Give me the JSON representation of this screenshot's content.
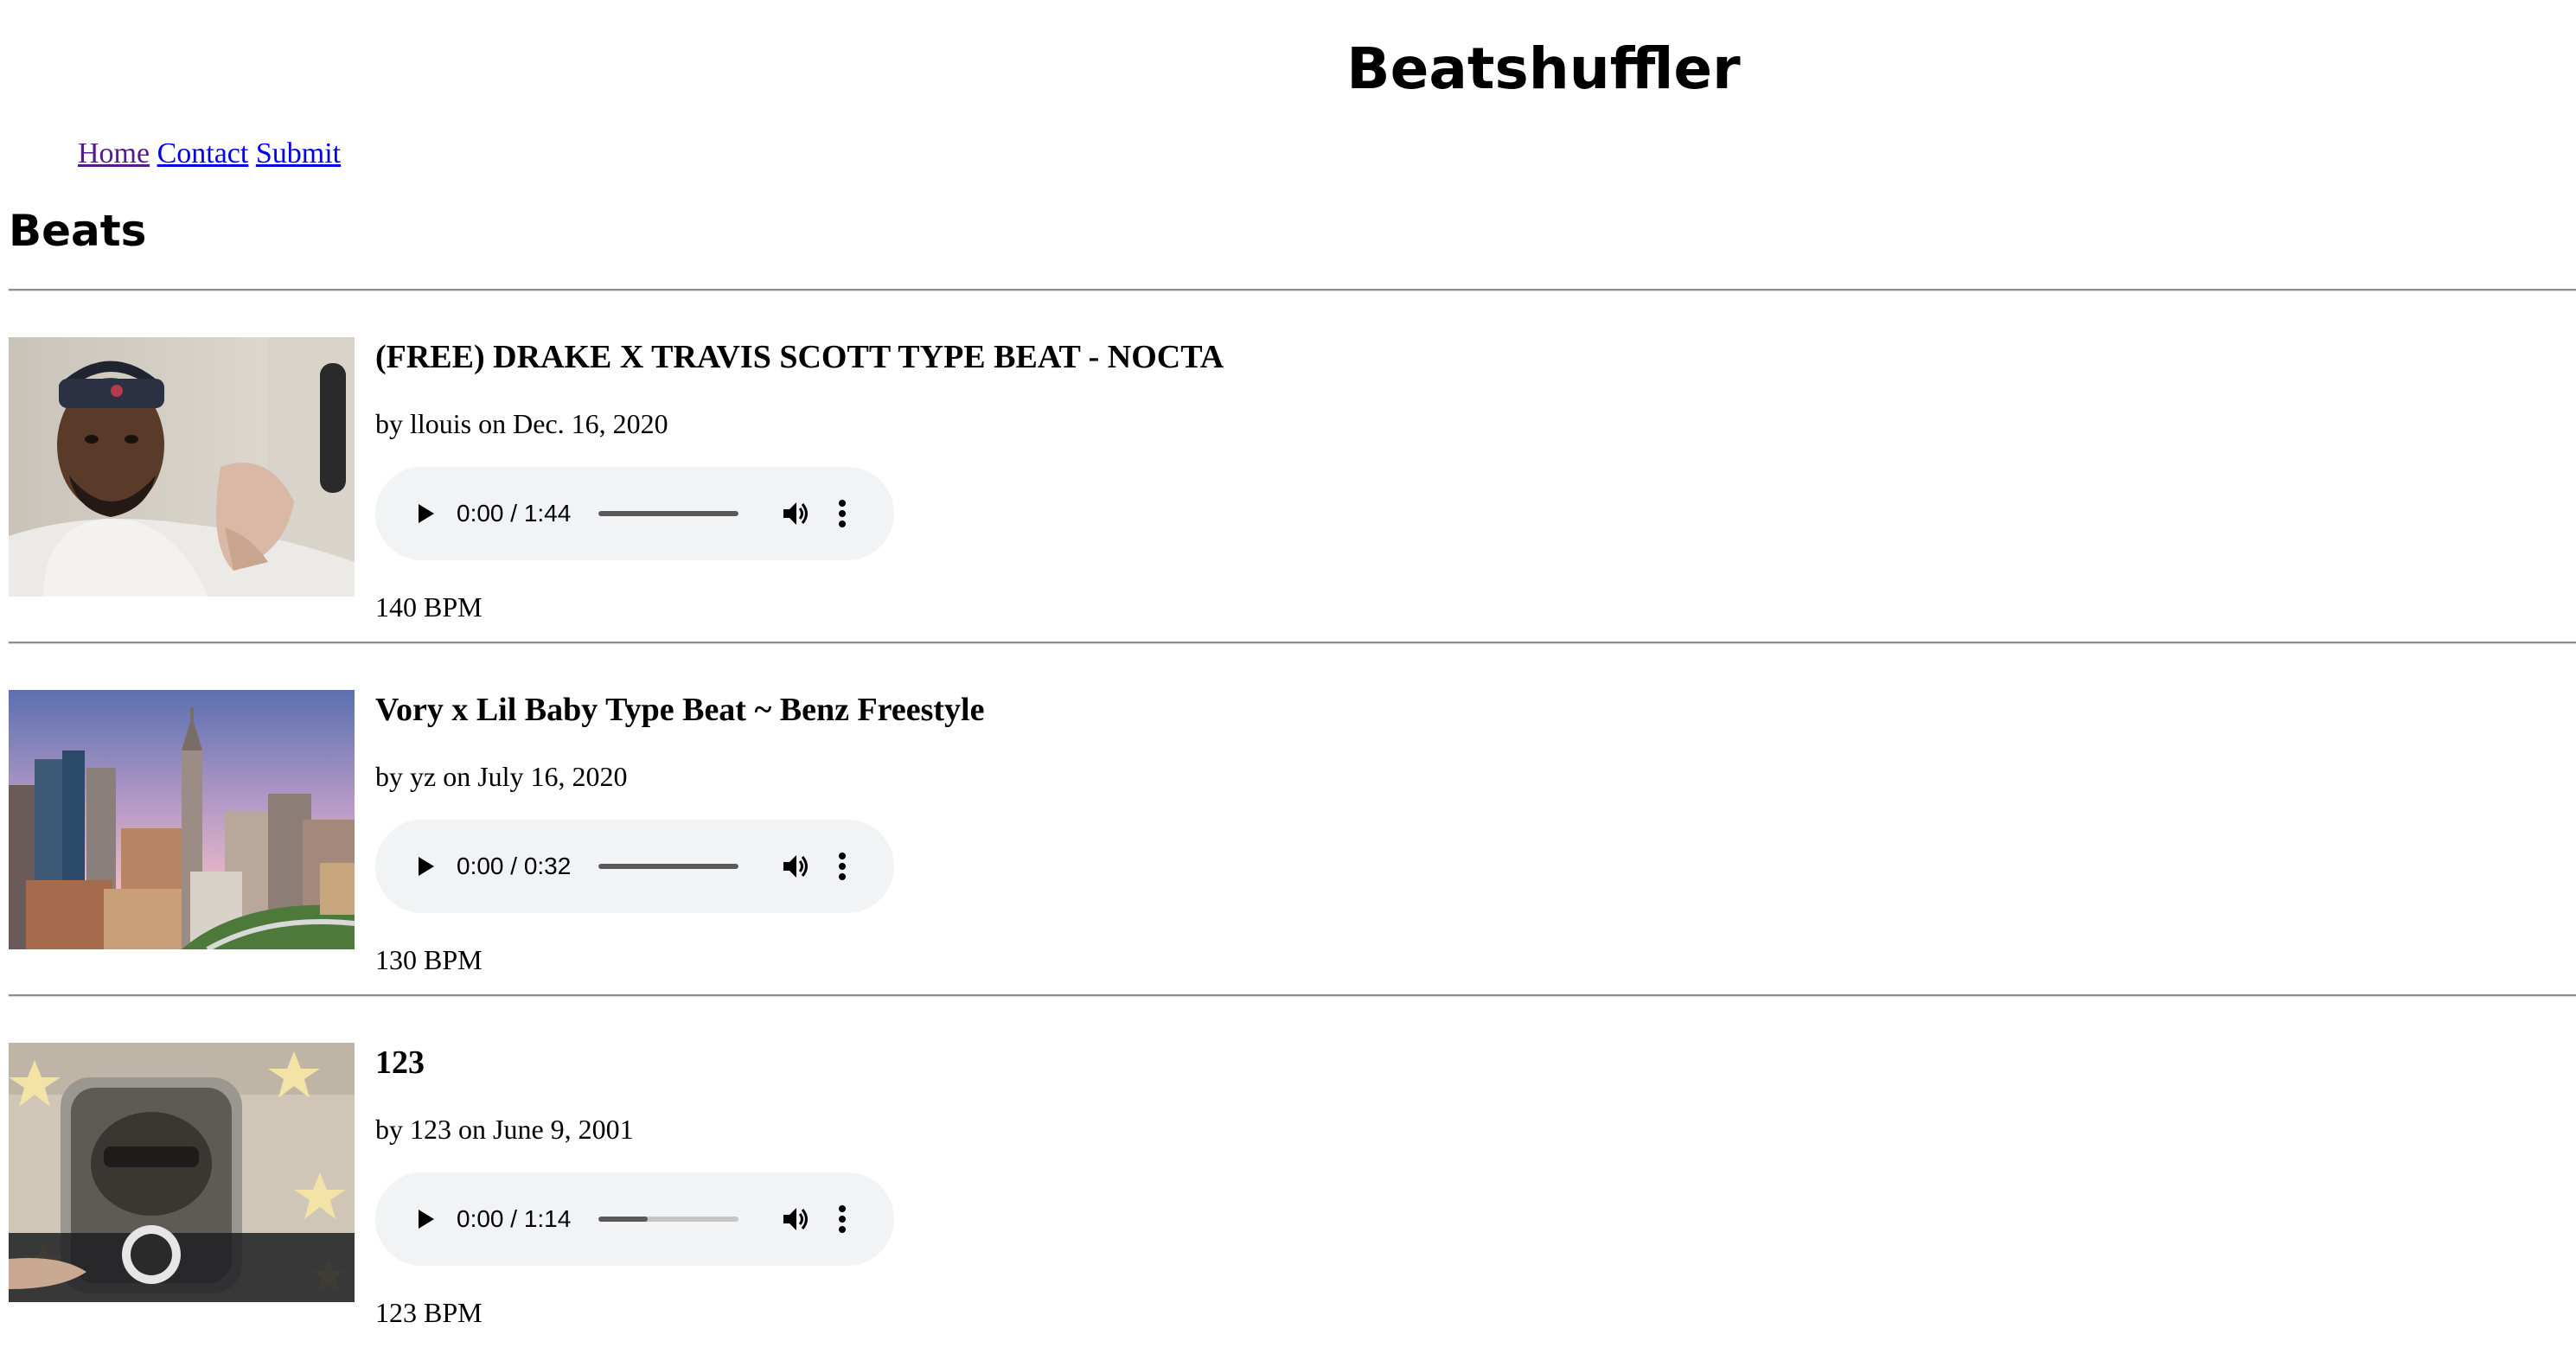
{
  "site": {
    "title": "Beatshuffler"
  },
  "nav": {
    "home": "Home",
    "contact": "Contact",
    "submit": "Submit"
  },
  "section": {
    "title": "Beats"
  },
  "beats": [
    {
      "title": "(FREE) DRAKE X TRAVIS SCOTT TYPE BEAT - NOCTA",
      "byline": "by llouis on Dec. 16, 2020",
      "time": "0:00 / 1:44",
      "progress": 1.0,
      "bpm": "140 BPM"
    },
    {
      "title": "Vory x Lil Baby Type Beat ~ Benz Freestyle",
      "byline": "by yz on July 16, 2020",
      "time": "0:00 / 0:32",
      "progress": 1.0,
      "bpm": "130 BPM"
    },
    {
      "title": "123",
      "byline": "by 123 on June 9, 2001",
      "time": "0:00 / 1:14",
      "progress": 0.35,
      "bpm": "123 BPM"
    }
  ],
  "icons": {
    "play": "play-icon",
    "volume": "volume-icon",
    "more": "more-vertical-icon"
  },
  "colors": {
    "link": "#0000ee",
    "visited_link": "#551a8b",
    "player_background": "#f1f3f4",
    "progress_fill": "#595959",
    "progress_track": "#c6c6c6"
  }
}
